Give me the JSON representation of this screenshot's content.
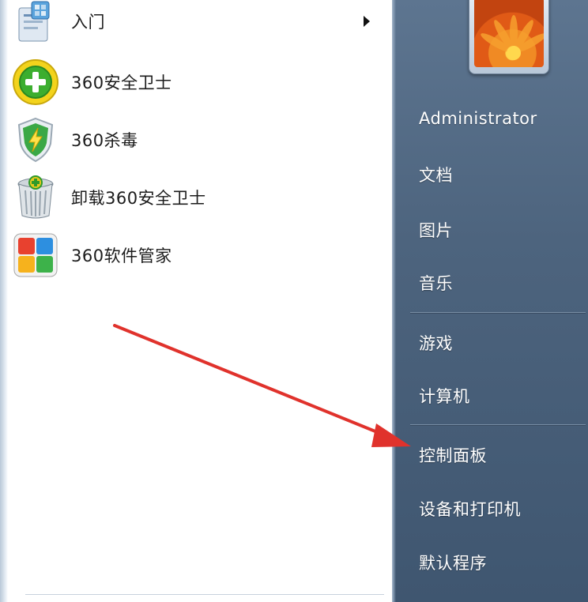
{
  "programs": [
    {
      "label": "入门",
      "icon": "getting-started-icon",
      "has_submenu": true
    },
    {
      "label": "360安全卫士",
      "icon": "360-safeguard-icon"
    },
    {
      "label": "360杀毒",
      "icon": "360-antivirus-shield-icon"
    },
    {
      "label": "卸载360安全卫士",
      "icon": "uninstall-recycle-bin-icon"
    },
    {
      "label": "360软件管家",
      "icon": "360-software-manager-icon"
    }
  ],
  "places": [
    {
      "label": "Administrator"
    },
    {
      "label": "文档"
    },
    {
      "label": "图片"
    },
    {
      "label": "音乐"
    },
    {
      "label": "游戏"
    },
    {
      "label": "计算机"
    },
    {
      "label": "控制面板"
    },
    {
      "label": "设备和打印机"
    },
    {
      "label": "默认程序"
    }
  ],
  "user_picture": "flower-photo",
  "annotation": {
    "icon": "red-arrow-pointing-at-control-panel",
    "color": "#e0322c"
  },
  "colors": {
    "right_pane": "#4d647e",
    "left_pane": "#ffffff",
    "arrow": "#e0322c"
  }
}
